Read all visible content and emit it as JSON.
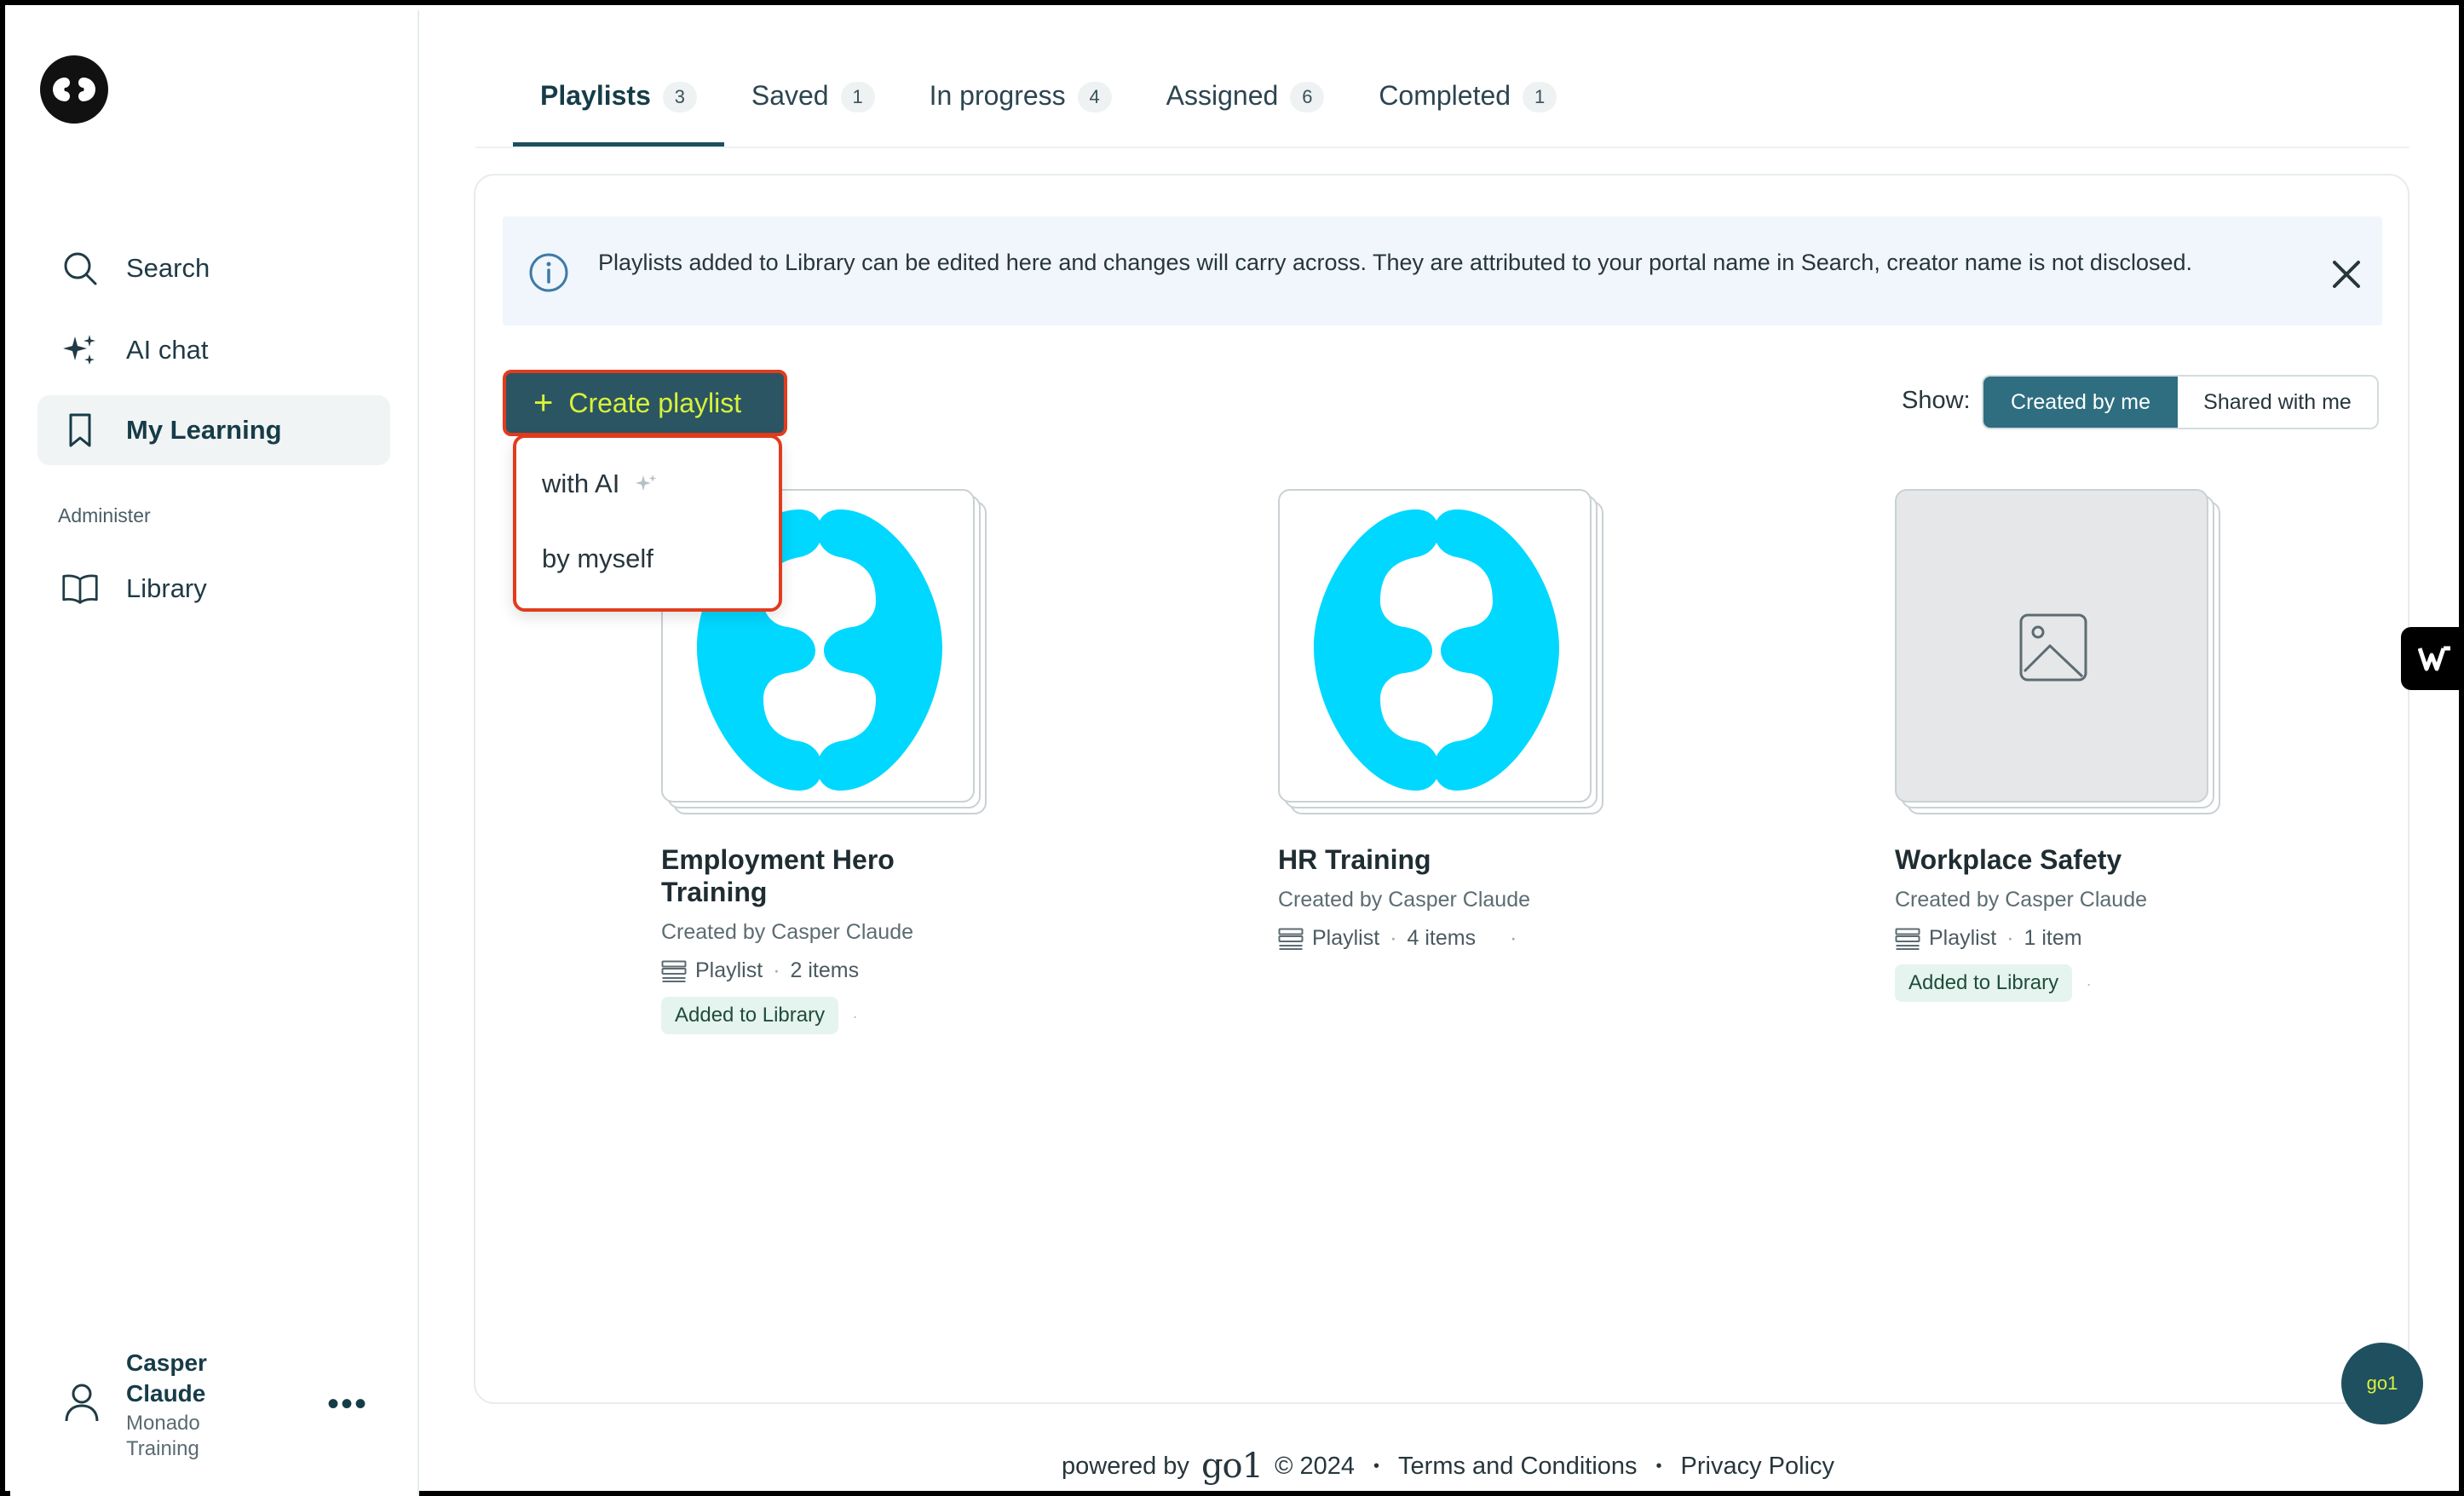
{
  "sidebar": {
    "nav": [
      {
        "label": "Search",
        "icon": "search-icon"
      },
      {
        "label": "AI chat",
        "icon": "sparkle-icon"
      },
      {
        "label": "My Learning",
        "icon": "bookmark-icon",
        "active": true
      }
    ],
    "section_label": "Administer",
    "admin_nav": [
      {
        "label": "Library",
        "icon": "book-icon"
      }
    ],
    "user": {
      "name": "Casper Claude",
      "org": "Monado Training"
    }
  },
  "tabs": [
    {
      "label": "Playlists",
      "count": "3",
      "active": true
    },
    {
      "label": "Saved",
      "count": "1"
    },
    {
      "label": "In progress",
      "count": "4"
    },
    {
      "label": "Assigned",
      "count": "6"
    },
    {
      "label": "Completed",
      "count": "1"
    }
  ],
  "banner": {
    "text": "Playlists added to Library can be edited here and changes will carry across. They are attributed to your portal name in Search, creator name is not disclosed."
  },
  "create_button": {
    "label": "Create playlist"
  },
  "dropdown": {
    "options": [
      "with AI",
      "by myself"
    ]
  },
  "show": {
    "label": "Show:",
    "options": [
      "Created by me",
      "Shared with me"
    ],
    "selected": "Created by me"
  },
  "cards": [
    {
      "title": "Employment Hero Training",
      "creator": "Created by Casper Claude",
      "type": "Playlist",
      "items": "2 items",
      "badge": "Added to Library"
    },
    {
      "title": "HR Training",
      "creator": "Created by Casper Claude",
      "type": "Playlist",
      "items": "4 items",
      "badge": ""
    },
    {
      "title": "Workplace Safety",
      "creator": "Created by Casper Claude",
      "type": "Playlist",
      "items": "1 item",
      "badge": "Added to Library"
    }
  ],
  "footer": {
    "powered_by": "powered by",
    "brand": "go1",
    "copyright": "© 2024",
    "terms": "Terms and Conditions",
    "privacy": "Privacy Policy"
  },
  "fab": {
    "label": "go1"
  },
  "colors": {
    "accent": "#2b5562",
    "highlight": "#d8f23a",
    "logo_cyan": "#00d8ff",
    "focus_outline": "#e13c1e"
  }
}
